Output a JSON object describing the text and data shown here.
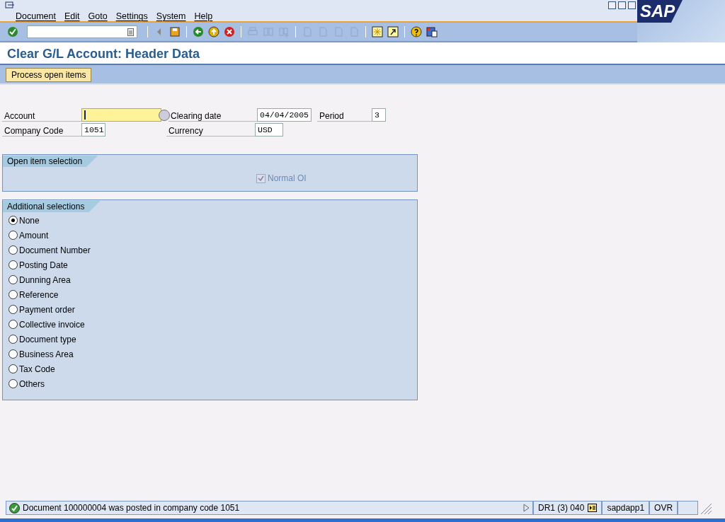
{
  "menu": [
    {
      "label": "Document"
    },
    {
      "label": "Edit"
    },
    {
      "label": "Goto"
    },
    {
      "label": "Settings"
    },
    {
      "label": "System"
    },
    {
      "label": "Help"
    }
  ],
  "logo": "SAP",
  "toolbar": [
    {
      "kind": "enter",
      "disabled": false
    },
    {
      "kind": "command"
    },
    {
      "kind": "sep"
    },
    {
      "kind": "collapse",
      "disabled": false
    },
    {
      "kind": "save",
      "disabled": false
    },
    {
      "kind": "sep"
    },
    {
      "kind": "back",
      "disabled": false
    },
    {
      "kind": "exit",
      "disabled": false
    },
    {
      "kind": "cancel",
      "disabled": false
    },
    {
      "kind": "sep"
    },
    {
      "kind": "print",
      "disabled": true
    },
    {
      "kind": "find",
      "disabled": true
    },
    {
      "kind": "find-next",
      "disabled": true
    },
    {
      "kind": "sep"
    },
    {
      "kind": "page",
      "disabled": true
    },
    {
      "kind": "page",
      "disabled": true
    },
    {
      "kind": "page",
      "disabled": true
    },
    {
      "kind": "page",
      "disabled": true
    },
    {
      "kind": "sep"
    },
    {
      "kind": "session",
      "disabled": false
    },
    {
      "kind": "shortcut",
      "disabled": false
    },
    {
      "kind": "sep"
    },
    {
      "kind": "help",
      "disabled": false
    },
    {
      "kind": "layout",
      "disabled": false
    }
  ],
  "title": "Clear G/L Account: Header Data",
  "app_toolbar": [
    "Process open items"
  ],
  "header_rows": [
    {
      "fields": [
        {
          "label": "Account",
          "focused": true,
          "help": true
        },
        {
          "label": "Clearing date",
          "value": "04/04/2005",
          "focused": false
        },
        {
          "label": "Period",
          "value": "3",
          "focused": false
        }
      ]
    },
    {
      "fields": [
        {
          "label": "Company Code",
          "value": "1051",
          "focused": false
        },
        {
          "label": "Currency",
          "value": "USD",
          "focused": false
        }
      ]
    }
  ],
  "open_item_selection": {
    "title": "Open item selection",
    "checkbox": {
      "label": "Normal OI",
      "checked": true,
      "disabled": true
    }
  },
  "additional_selections": {
    "title": "Additional selections",
    "options": [
      {
        "label": "None",
        "selected": true
      },
      {
        "label": "Amount",
        "selected": false
      },
      {
        "label": "Document Number",
        "selected": false
      },
      {
        "label": "Posting Date",
        "selected": false
      },
      {
        "label": "Dunning Area",
        "selected": false
      },
      {
        "label": "Reference",
        "selected": false
      },
      {
        "label": "Payment order",
        "selected": false
      },
      {
        "label": "Collective invoice",
        "selected": false
      },
      {
        "label": "Document type",
        "selected": false
      },
      {
        "label": "Business Area",
        "selected": false
      },
      {
        "label": "Tax Code",
        "selected": false
      },
      {
        "label": "Others",
        "selected": false
      }
    ]
  },
  "status_bar": {
    "message": "Document 100000004 was posted in company code 1051",
    "system": "DR1 (3) 040",
    "server": "sapdapp1",
    "mode": "OVR"
  }
}
